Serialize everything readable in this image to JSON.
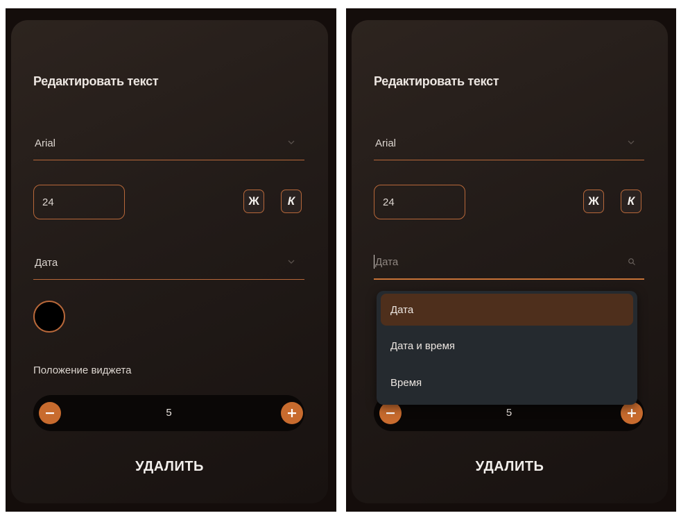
{
  "left_panel": {
    "title": "Редактировать текст",
    "font_select": {
      "value": "Arial"
    },
    "font_size": "24",
    "bold_label": "Ж",
    "italic_label": "К",
    "type_select": {
      "value": "Дата"
    },
    "position_label": "Положение виджета",
    "stepper_value": "5",
    "delete_label": "УДАЛИТЬ"
  },
  "right_panel": {
    "title": "Редактировать текст",
    "font_select": {
      "value": "Arial"
    },
    "font_size": "24",
    "bold_label": "Ж",
    "italic_label": "К",
    "type_search": {
      "placeholder": "Дата"
    },
    "dropdown_options": [
      "Дата",
      "Дата и время",
      "Время"
    ],
    "selected_option": "Дата",
    "stepper_value": "5",
    "delete_label": "УДАЛИТЬ"
  },
  "colors": {
    "accent": "#c86b2e",
    "card_bg": "#221b18",
    "selected_option_bg": "#4e2f1c",
    "dropdown_bg": "#252a2f"
  }
}
